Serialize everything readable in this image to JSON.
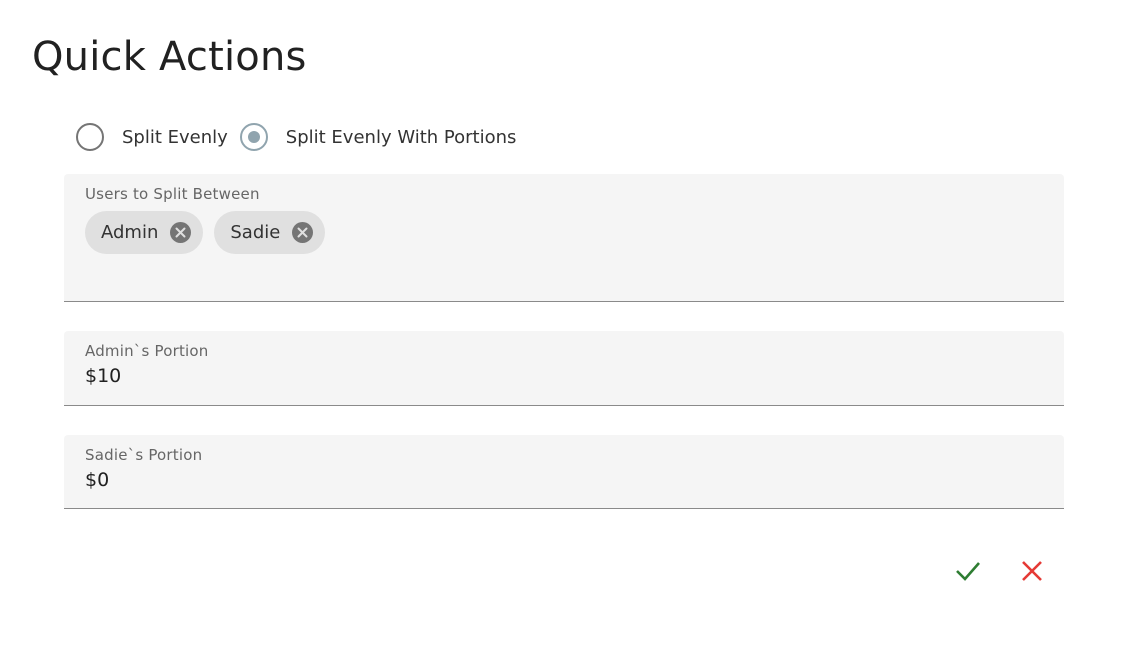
{
  "dialog": {
    "title": "Quick Actions"
  },
  "split_mode": {
    "options": [
      {
        "label": "Split Evenly",
        "selected": false
      },
      {
        "label": "Split Evenly With Portions",
        "selected": true
      }
    ]
  },
  "users_field": {
    "label": "Users to Split Between",
    "chips": [
      "Admin",
      "Sadie"
    ]
  },
  "portions": [
    {
      "label": "Admin`s Portion",
      "value": "$10"
    },
    {
      "label": "Sadie`s Portion",
      "value": "$0"
    }
  ],
  "actions": {
    "confirm_icon": "check-icon",
    "cancel_icon": "close-icon"
  },
  "colors": {
    "confirm": "#2e7d32",
    "cancel": "#e53935",
    "radio_checked": "#90a4ae",
    "field_background": "#f5f5f5",
    "chip_background": "#e0e0e0"
  }
}
